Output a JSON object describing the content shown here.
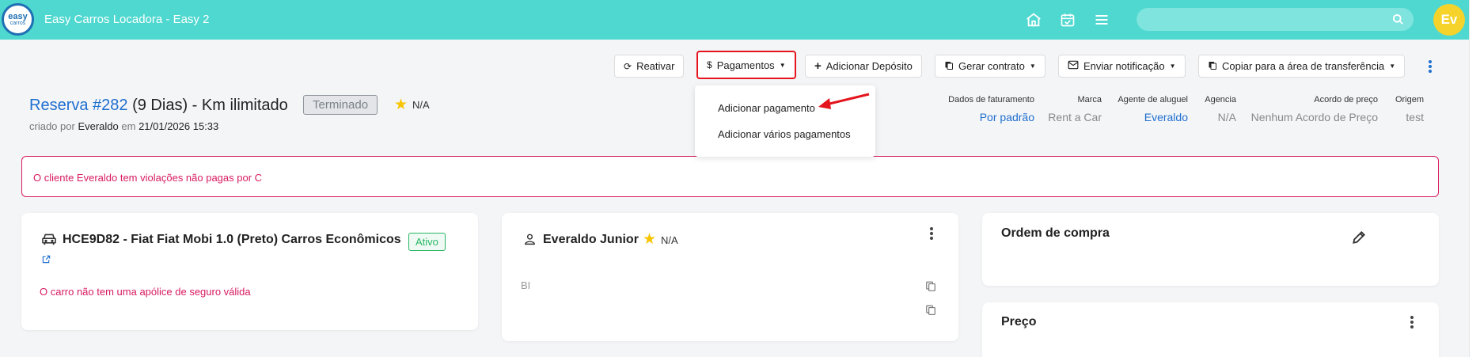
{
  "app": {
    "logo_line1": "easy",
    "logo_line2": "carros",
    "title": "Easy Carros Locadora - Easy 2",
    "avatar_initials": "Ev",
    "search": {
      "value": "",
      "placeholder": ""
    }
  },
  "toolbar": {
    "reactivate": "Reativar",
    "payments": "Pagamentos",
    "add_deposit": "Adicionar Depósito",
    "generate_contract": "Gerar contrato",
    "send_notification": "Enviar notificação",
    "copy_clipboard": "Copiar para a área de transferência"
  },
  "payments_menu": {
    "items": [
      "Adicionar pagamento",
      "Adicionar vários pagamentos"
    ]
  },
  "reservation": {
    "title_link": "Reserva #282",
    "days": "(9 Dias)",
    "km": "- Km ilimitado",
    "status": "Terminado",
    "rating": "N/A",
    "created_by_label": "criado por",
    "created_by": "Everaldo",
    "on_label": "em",
    "created_at": "21/01/2026 15:33"
  },
  "meta": [
    {
      "label": "Dados de faturamento",
      "value": "Por padrão",
      "link": true
    },
    {
      "label": "Marca",
      "value": "Rent a Car",
      "link": false
    },
    {
      "label": "Agente de aluguel",
      "value": "Everaldo",
      "link": true
    },
    {
      "label": "Agencia",
      "value": "N/A",
      "link": false
    },
    {
      "label": "Acordo de preço",
      "value": "Nenhum Acordo de Preço",
      "link": false
    },
    {
      "label": "Origem",
      "value": "test",
      "link": false
    }
  ],
  "alert": {
    "text": "O cliente Everaldo tem violações não pagas por C"
  },
  "car_card": {
    "title": "HCE9D82 - Fiat Fiat Mobi 1.0 (Preto) Carros Econômicos",
    "status": "Ativo",
    "warning": "O carro não tem uma apólice de seguro válida"
  },
  "customer_card": {
    "name": "Everaldo Junior",
    "rating": "N/A",
    "field": "BI"
  },
  "purchase_order_card": {
    "title": "Ordem de compra"
  },
  "price_card": {
    "title": "Preço"
  },
  "colors": {
    "topbar": "#4ed8cf",
    "link": "#1f6fd0",
    "danger": "#d81b60",
    "success": "#29b765",
    "highlight": "#e4141c"
  }
}
